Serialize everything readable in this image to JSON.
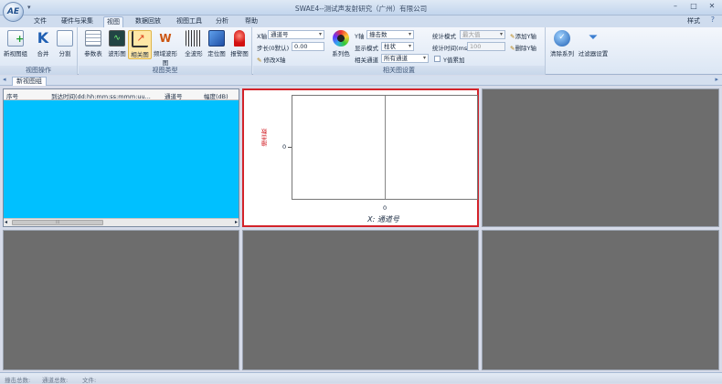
{
  "window": {
    "title": "SWAE4--测试声发射研究（广州）有限公司",
    "qat": "▾"
  },
  "tabs": {
    "file": "文件",
    "hardware": "硬件与采集",
    "view": "视图",
    "replay": "数据回放",
    "view_tools": "视图工具",
    "analysis": "分析",
    "help": "帮助",
    "style": "样式"
  },
  "ribbon": {
    "view_ops": {
      "title": "视图操作",
      "new_view_group": "新视图组",
      "merge": "合并",
      "split": "分割"
    },
    "view_types": {
      "title": "视图类型",
      "params_table": "参数表",
      "waveform": "波形图",
      "correlation": "相关图",
      "freq_wave": "频域波形图",
      "full_wave": "全波形",
      "location": "定位图",
      "alarm": "报警图"
    },
    "corr_settings": {
      "title": "相关图设置",
      "x_axis_label": "X轴",
      "x_axis_value": "通道号",
      "step_label": "步长(0默认)",
      "step_value": "0.00",
      "modify_x": "修改X轴",
      "series_color": "系列色",
      "y_axis_label": "Y轴",
      "y_axis_value": "撞击数",
      "display_mode_label": "显示模式",
      "display_mode_value": "柱状",
      "related_channel_label": "相关通道",
      "related_channel_value": "所有通道",
      "stat_mode_label": "统计模式",
      "stat_mode_value": "最大值",
      "stat_time_label": "统计时间(ms)",
      "stat_time_value": "100",
      "y_accumulate": "Y值累加",
      "add_y": "添加Y轴",
      "delete_y": "删除Y轴",
      "clear_series": "清除系列",
      "filter_settings": "过滤器设置"
    }
  },
  "doc_tab": "新视图组",
  "table": {
    "columns": [
      "序号",
      "到达时间(dd:hh:mm:ss:mmm:uu...",
      "通道号",
      "幅度(dB)"
    ],
    "scroll_grip": "⁞⁞⁞"
  },
  "chart_data": {
    "type": "bar",
    "xlabel": "X: 通道号",
    "ylabel": "撞击数",
    "x_ticks": [
      "0"
    ],
    "y_ticks": [
      "0"
    ],
    "series": [
      {
        "values": []
      }
    ],
    "grid": false
  },
  "status": {
    "hits": "撞击总数:",
    "channels": "通道总数:",
    "file": "文件:"
  },
  "colors": {
    "selected_panel_border": "#d3232a",
    "list_background": "#00c0ff",
    "empty_panel": "#6d6d6d"
  }
}
